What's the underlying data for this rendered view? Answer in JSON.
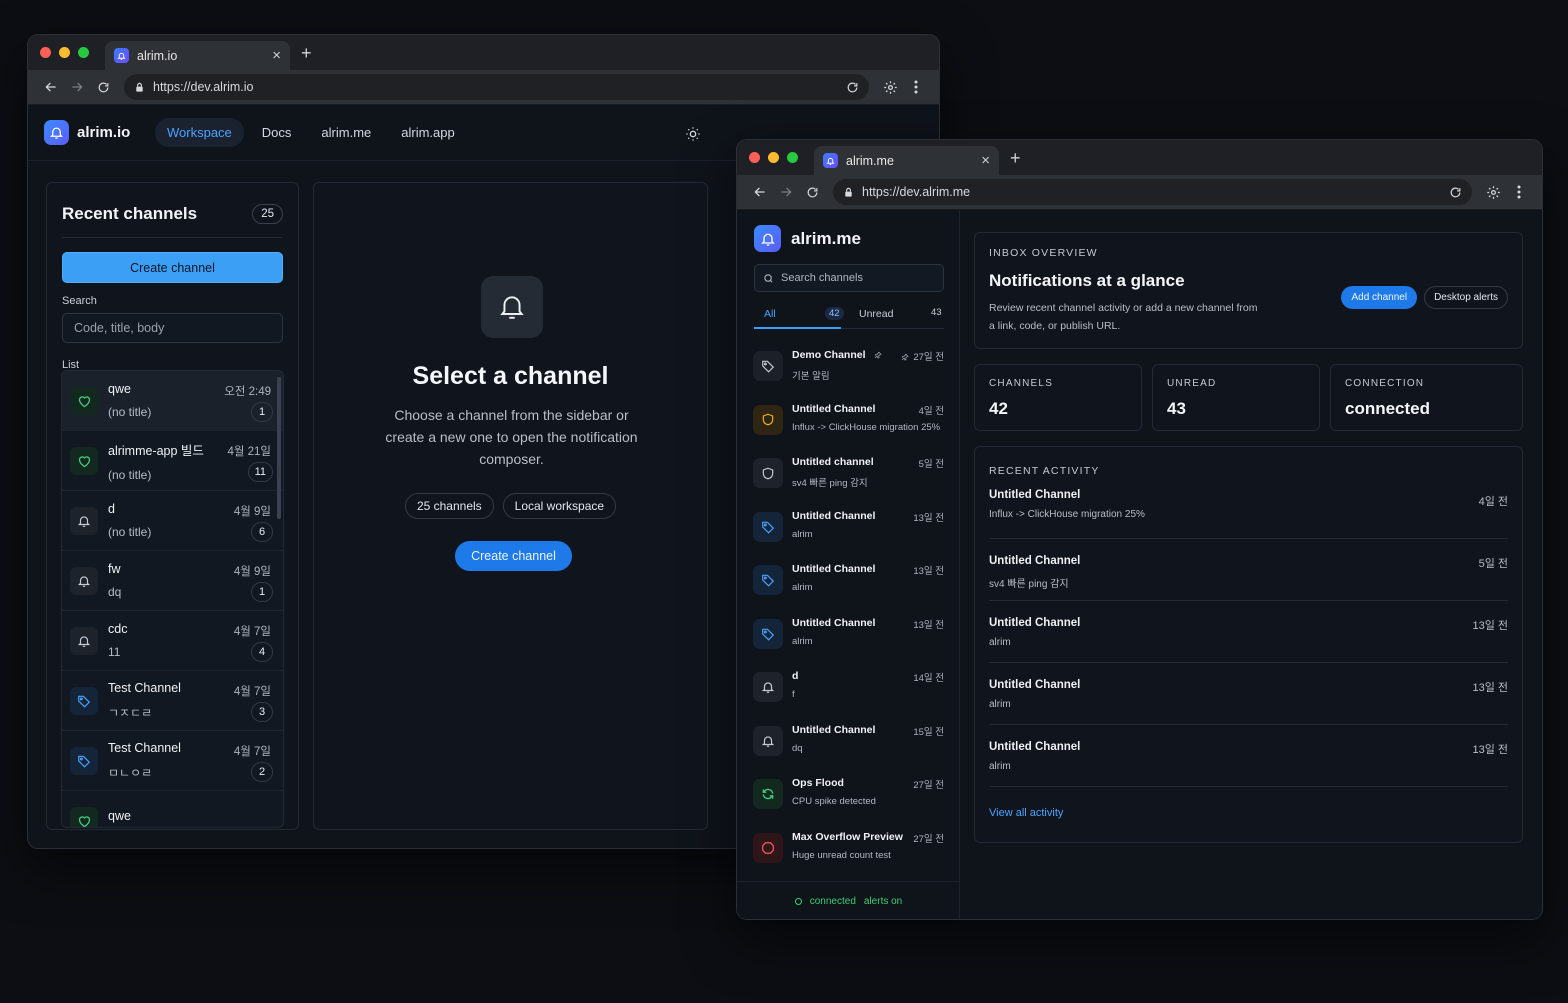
{
  "io_window": {
    "tab_title": "alrim.io",
    "url": "https://dev.alrim.io",
    "brand": "alrim.io",
    "nav": [
      "Workspace",
      "Docs",
      "alrim.me",
      "alrim.app"
    ],
    "sidebar": {
      "title": "Recent channels",
      "count": "25",
      "create_label": "Create channel",
      "search_label": "Search",
      "search_placeholder": "Code, title, body",
      "list_label": "List",
      "items": [
        {
          "name": "qwe",
          "sub": "(no title)",
          "time": "오전 2:49",
          "badge": "1",
          "icon": "heart-icon",
          "tone": "green"
        },
        {
          "name": "alrimme-app 빌드",
          "sub": "(no title)",
          "time": "4월 21일",
          "badge": "11",
          "icon": "heart-icon",
          "tone": "green"
        },
        {
          "name": "d",
          "sub": "(no title)",
          "time": "4월 9일",
          "badge": "6",
          "icon": "bell-icon",
          "tone": "gray"
        },
        {
          "name": "fw",
          "sub": "dq",
          "time": "4월 9일",
          "badge": "1",
          "icon": "bell-icon",
          "tone": "gray"
        },
        {
          "name": "cdc",
          "sub": "11",
          "time": "4월 7일",
          "badge": "4",
          "icon": "bell-icon",
          "tone": "gray"
        },
        {
          "name": "Test Channel",
          "sub": "ㄱㅈㄷㄹ",
          "time": "4월 7일",
          "badge": "3",
          "icon": "tag-icon",
          "tone": "blue"
        },
        {
          "name": "Test Channel",
          "sub": "ㅁㄴㅇㄹ",
          "time": "4월 7일",
          "badge": "2",
          "icon": "tag-icon",
          "tone": "blue"
        },
        {
          "name": "qwe",
          "sub": "",
          "time": "",
          "badge": "",
          "icon": "heart-icon",
          "tone": "green"
        }
      ]
    },
    "empty": {
      "title": "Select a channel",
      "description": "Choose a channel from the sidebar or create a new one to open the notification composer.",
      "chips": [
        "25 channels",
        "Local workspace"
      ],
      "button": "Create channel"
    }
  },
  "me_window": {
    "tab_title": "alrim.me",
    "url": "https://dev.alrim.me",
    "brand": "alrim.me",
    "search_placeholder": "Search channels",
    "tabs": {
      "all": "All",
      "all_count": "42",
      "unread": "Unread",
      "unread_count": "43"
    },
    "items": [
      {
        "name": "Demo Channel",
        "sub": "기본 알림",
        "time": "27일 전",
        "icon": "tag-icon",
        "tone": "dark",
        "pinned": true
      },
      {
        "name": "Untitled Channel",
        "sub": "Influx -> ClickHouse migration 25%",
        "time": "4일 전",
        "icon": "shield-icon",
        "tone": "yellow"
      },
      {
        "name": "Untitled channel",
        "sub": "sv4 빠른 ping 감지",
        "time": "5일 전",
        "icon": "shield-icon",
        "tone": "gray"
      },
      {
        "name": "Untitled Channel",
        "sub": "alrim",
        "time": "13일 전",
        "icon": "tag-icon",
        "tone": "blue"
      },
      {
        "name": "Untitled Channel",
        "sub": "alrim",
        "time": "13일 전",
        "icon": "tag-icon",
        "tone": "blue"
      },
      {
        "name": "Untitled Channel",
        "sub": "alrim",
        "time": "13일 전",
        "icon": "tag-icon",
        "tone": "blue"
      },
      {
        "name": "d",
        "sub": "f",
        "time": "14일 전",
        "icon": "bell-icon",
        "tone": "gray"
      },
      {
        "name": "Untitled Channel",
        "sub": "dq",
        "time": "15일 전",
        "icon": "bell-icon",
        "tone": "gray"
      },
      {
        "name": "Ops Flood",
        "sub": "CPU spike detected",
        "time": "27일 전",
        "icon": "refresh-icon",
        "tone": "green"
      },
      {
        "name": "Max Overflow Preview",
        "sub": "Huge unread count test",
        "time": "27일 전",
        "icon": "octagon-icon",
        "tone": "red"
      }
    ],
    "status": {
      "connected": "connected",
      "alerts": "alerts on"
    },
    "overview": {
      "eyebrow": "INBOX OVERVIEW",
      "title": "Notifications at a glance",
      "description": "Review recent channel activity or add a new channel from a link, code, or publish URL.",
      "add_button": "Add channel",
      "alerts_button": "Desktop alerts"
    },
    "stats": [
      {
        "label": "CHANNELS",
        "value": "42"
      },
      {
        "label": "UNREAD",
        "value": "43"
      },
      {
        "label": "CONNECTION",
        "value": "connected"
      }
    ],
    "activity": {
      "eyebrow": "RECENT ACTIVITY",
      "rows": [
        {
          "name": "Untitled Channel",
          "sub": "Influx -> ClickHouse migration 25%",
          "time": "4일 전"
        },
        {
          "name": "Untitled Channel",
          "sub": "sv4 빠른 ping 감지",
          "time": "5일 전"
        },
        {
          "name": "Untitled Channel",
          "sub": "alrim",
          "time": "13일 전"
        },
        {
          "name": "Untitled Channel",
          "sub": "alrim",
          "time": "13일 전"
        },
        {
          "name": "Untitled Channel",
          "sub": "alrim",
          "time": "13일 전"
        }
      ],
      "link": "View all activity"
    }
  },
  "colors": {
    "accent": "#3b9ff6",
    "background": "#0c0e13",
    "success": "#3ccf74"
  }
}
